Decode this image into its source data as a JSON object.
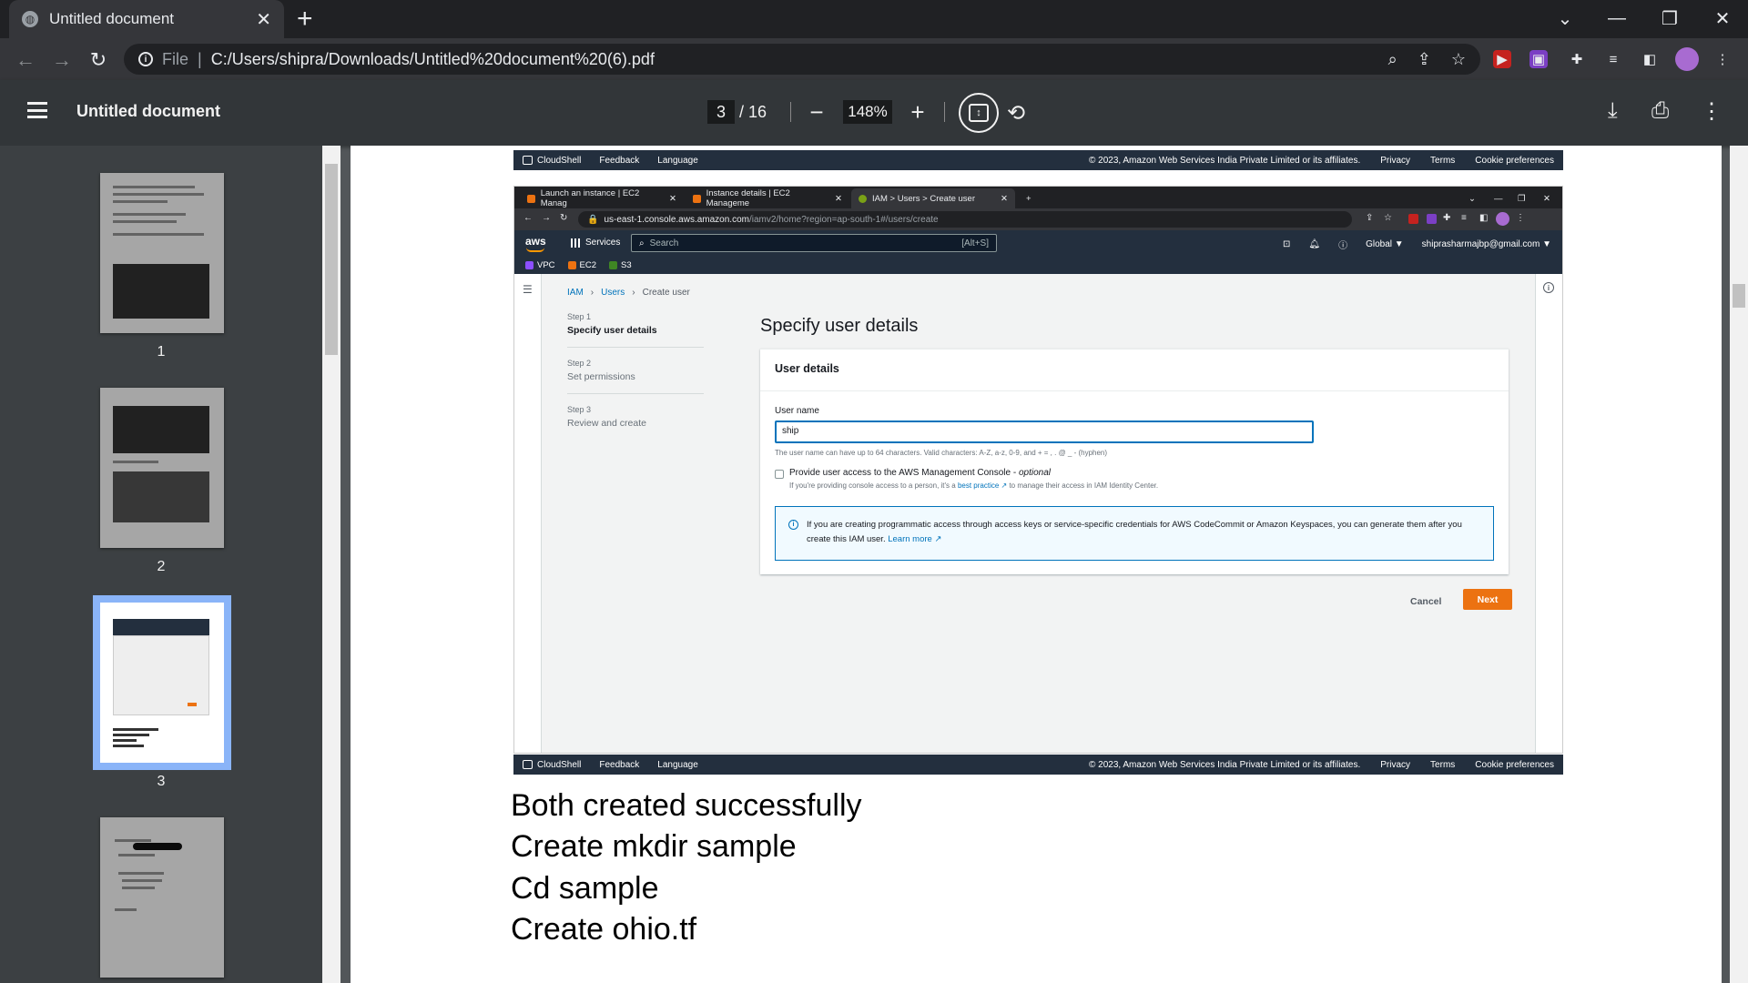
{
  "browser": {
    "tab_title": "Untitled document",
    "address_scheme": "File",
    "address_url": "C:/Users/shipra/Downloads/Untitled%20document%20(6).pdf"
  },
  "pdf_toolbar": {
    "title": "Untitled document",
    "current_page": "3",
    "total_pages": "/ 16",
    "zoom": "148%"
  },
  "thumbnails": [
    {
      "label": "1"
    },
    {
      "label": "2"
    },
    {
      "label": "3",
      "selected": true
    },
    {
      "label": ""
    }
  ],
  "aws_footer": {
    "cloudshell": "CloudShell",
    "feedback": "Feedback",
    "language": "Language",
    "copyright": "© 2023, Amazon Web Services India Private Limited or its affiliates.",
    "privacy": "Privacy",
    "terms": "Terms",
    "cookie": "Cookie preferences"
  },
  "inner_browser": {
    "tabs": [
      {
        "title": "Launch an instance | EC2 Manag"
      },
      {
        "title": "Instance details | EC2 Manageme"
      },
      {
        "title": "IAM > Users > Create user"
      }
    ],
    "url_host": "us-east-1.console.aws.amazon.com",
    "url_path": "/iamv2/home?region=ap-south-1#/users/create"
  },
  "aws_nav": {
    "logo": "aws",
    "services": "Services",
    "search_placeholder": "Search",
    "search_shortcut": "[Alt+S]",
    "region": "Global ▼",
    "account": "shiprasharmajbp@gmail.com ▼",
    "favorites": [
      "VPC",
      "EC2",
      "S3"
    ]
  },
  "iam": {
    "breadcrumb": [
      "IAM",
      "Users",
      "Create user"
    ],
    "steps": [
      {
        "num": "Step 1",
        "title": "Specify user details"
      },
      {
        "num": "Step 2",
        "title": "Set permissions"
      },
      {
        "num": "Step 3",
        "title": "Review and create"
      }
    ],
    "page_title": "Specify user details",
    "card_title": "User details",
    "username_label": "User name",
    "username_value": "ship",
    "username_hint": "The user name can have up to 64 characters. Valid characters: A-Z, a-z, 0-9, and + = , . @ _ - (hyphen)",
    "console_access_label": "Provide user access to the AWS Management Console - ",
    "console_access_optional": "optional",
    "console_hint_pre": "If you're providing console access to a person, it's a ",
    "console_hint_link": "best practice",
    "console_hint_post": " to manage their access in IAM Identity Center.",
    "info_text": "If you are creating programmatic access through access keys or service-specific credentials for AWS CodeCommit or Amazon Keyspaces, you can generate them after you create this IAM user.",
    "info_link": "Learn more",
    "cancel": "Cancel",
    "next": "Next"
  },
  "doc_lines": [
    "Both created successfully",
    "Create mkdir sample",
    "Cd sample",
    "Create ohio.tf"
  ]
}
